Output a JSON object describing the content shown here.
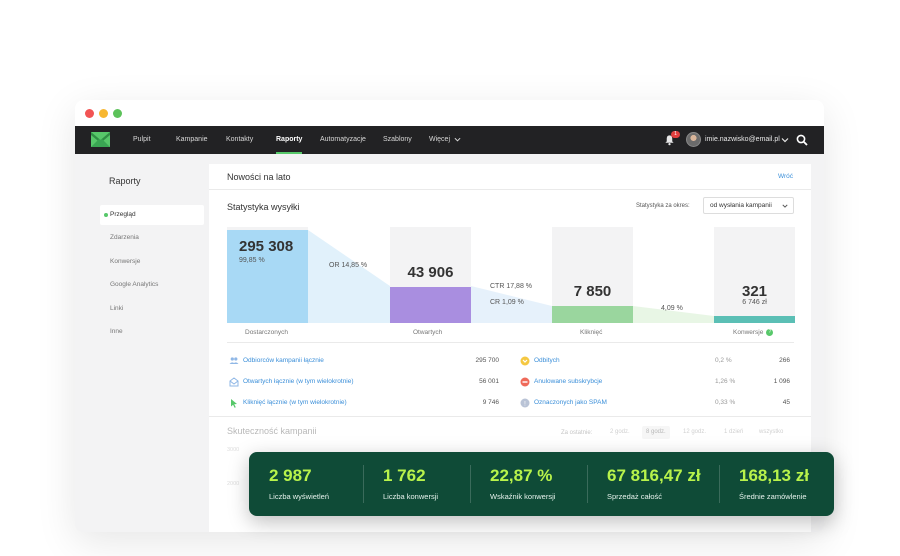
{
  "nav": {
    "items": [
      "Pulpit",
      "Kampanie",
      "Kontakty",
      "Raporty",
      "Automatyzacje",
      "Szablony",
      "Więcej"
    ],
    "active": "Raporty",
    "notifications": "1",
    "user_email": "imie.nazwisko@email.pl"
  },
  "sidebar": {
    "title": "Raporty",
    "items": [
      "Przegląd",
      "Zdarzenia",
      "Konwersje",
      "Google Analytics",
      "Linki",
      "Inne"
    ]
  },
  "main": {
    "campaign_title": "Nowości na lato",
    "back": "Wróć",
    "stats_title": "Statystyka wysyłki",
    "period_label": "Statystyka za okres:",
    "period_value": "od wysłania kampanii"
  },
  "funnel": {
    "delivered": {
      "value": "295 308",
      "pct": "99,85 %",
      "label": "Dostarczonych",
      "fill": 0.97
    },
    "opened": {
      "value": "43 906",
      "label": "Otwartych",
      "fill": 0.38
    },
    "clicked": {
      "value": "7 850",
      "label": "Kliknięć",
      "fill": 0.18
    },
    "conversions": {
      "value": "321",
      "sub": "6 746 zł",
      "label": "Konwersje",
      "fill": 0.07
    },
    "or": "OR 14,85 %",
    "ctr": "CTR 17,88 %",
    "cr": "CR 1,09 %",
    "conv_rate": "4,09 %",
    "help": "?"
  },
  "stats_left": [
    {
      "label": "Odbiorców kampanii łącznie",
      "value": "295 700",
      "icon": "users-icon"
    },
    {
      "label": "Otwartych łącznie (w tym wielokrotnie)",
      "value": "56 001",
      "icon": "envelope-open-icon"
    },
    {
      "label": "Kliknięć łącznie (w tym wielokrotnie)",
      "value": "9 746",
      "icon": "cursor-icon"
    }
  ],
  "stats_right": [
    {
      "label": "Odbitych",
      "pct": "0,2 %",
      "value": "266",
      "icon": "bounce-icon"
    },
    {
      "label": "Anulowane subskrybcje",
      "pct": "1,26 %",
      "value": "1 096",
      "icon": "unsubscribe-icon"
    },
    {
      "label": "Oznaczonych jako SPAM",
      "pct": "0,33 %",
      "value": "45",
      "icon": "spam-icon"
    }
  ],
  "effectiveness": {
    "title": "Skuteczność kampanii",
    "range_label": "Za ostatnie:",
    "ranges": [
      "2 godz.",
      "8 godz.",
      "12 godz.",
      "1 dzień",
      "wszystko"
    ],
    "active_range": "8 godz.",
    "axis": [
      "3000",
      "2000"
    ]
  },
  "kpis": [
    {
      "value": "2 987",
      "label": "Liczba wyświetleń"
    },
    {
      "value": "1 762",
      "label": "Liczba konwersji"
    },
    {
      "value": "22,87 %",
      "label": "Wskaźnik konwersji"
    },
    {
      "value": "67 816,47 zł",
      "label": "Sprzedaż całość"
    },
    {
      "value": "168,13 zł",
      "label": "Średnie zamówlenie"
    }
  ],
  "colors": {
    "accent": "#57c86a",
    "delivered": "#a8d9f5",
    "opened": "#a98ee0",
    "clicked": "#9ad69e",
    "conversions": "#5bbfb5",
    "kpi_bg": "#0f4b37",
    "kpi_value": "#b8f34b"
  }
}
